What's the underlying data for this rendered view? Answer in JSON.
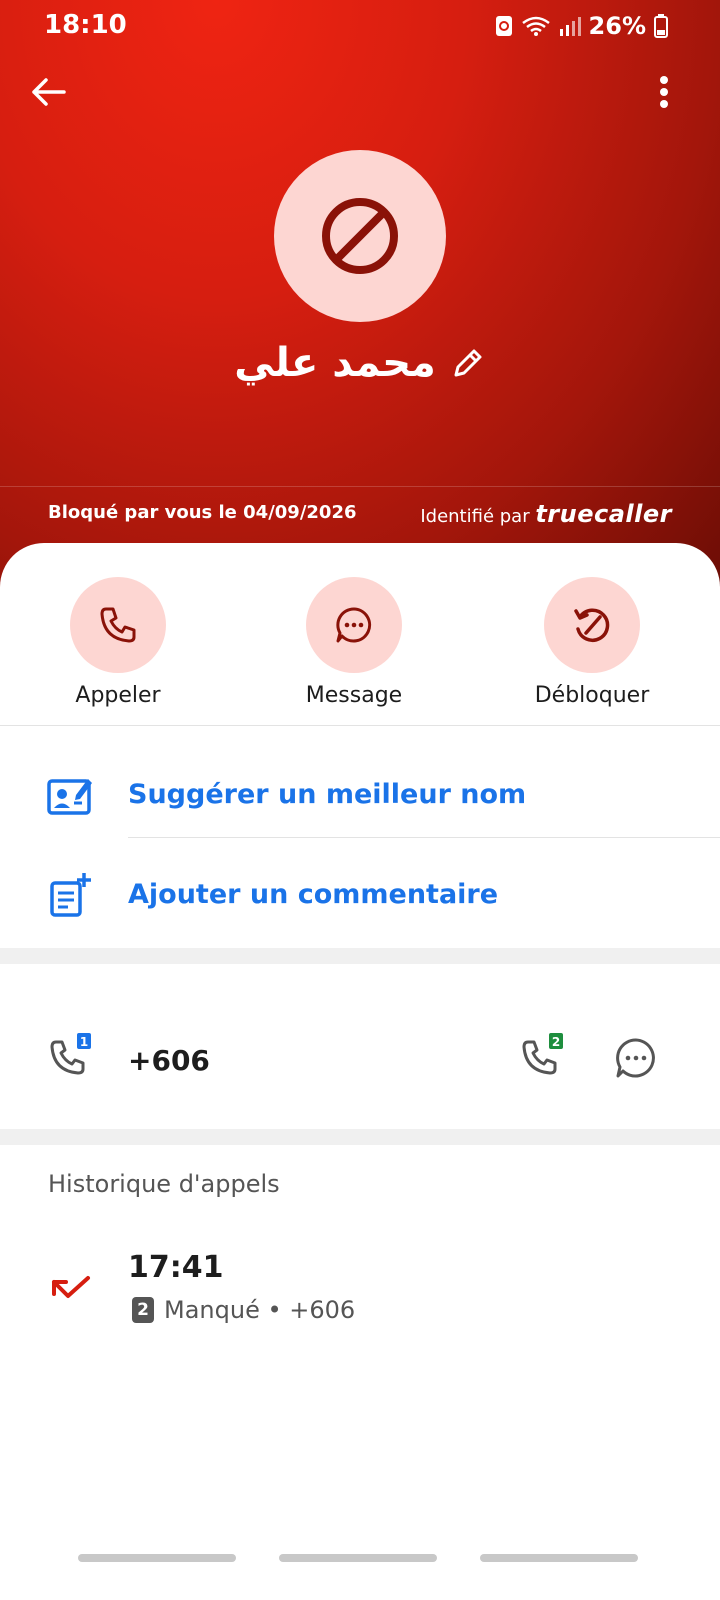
{
  "status_bar": {
    "time": "18:10",
    "battery": "26%"
  },
  "contact": {
    "name": "محمد علي",
    "blocked_text": "Bloqué par vous le 04/09/2026",
    "identified_prefix": "Identifié par",
    "identified_brand": "truecaller"
  },
  "actions": [
    {
      "label": "Appeler"
    },
    {
      "label": "Message"
    },
    {
      "label": "Débloquer"
    }
  ],
  "options": {
    "suggest_name": "Suggérer un meilleur nom",
    "add_comment": "Ajouter un commentaire"
  },
  "phone": {
    "number": "+606",
    "sim1_badge": "1",
    "sim2_badge": "2"
  },
  "history": {
    "title": "Historique d'appels",
    "entries": [
      {
        "time": "17:41",
        "sim": "2",
        "status": "Manqué • +606"
      }
    ]
  },
  "colors": {
    "header_red": "#d61e10",
    "accent_blue": "#1a73e8",
    "pink_circle": "#fdd6d2",
    "icon_red": "#8a1208"
  }
}
